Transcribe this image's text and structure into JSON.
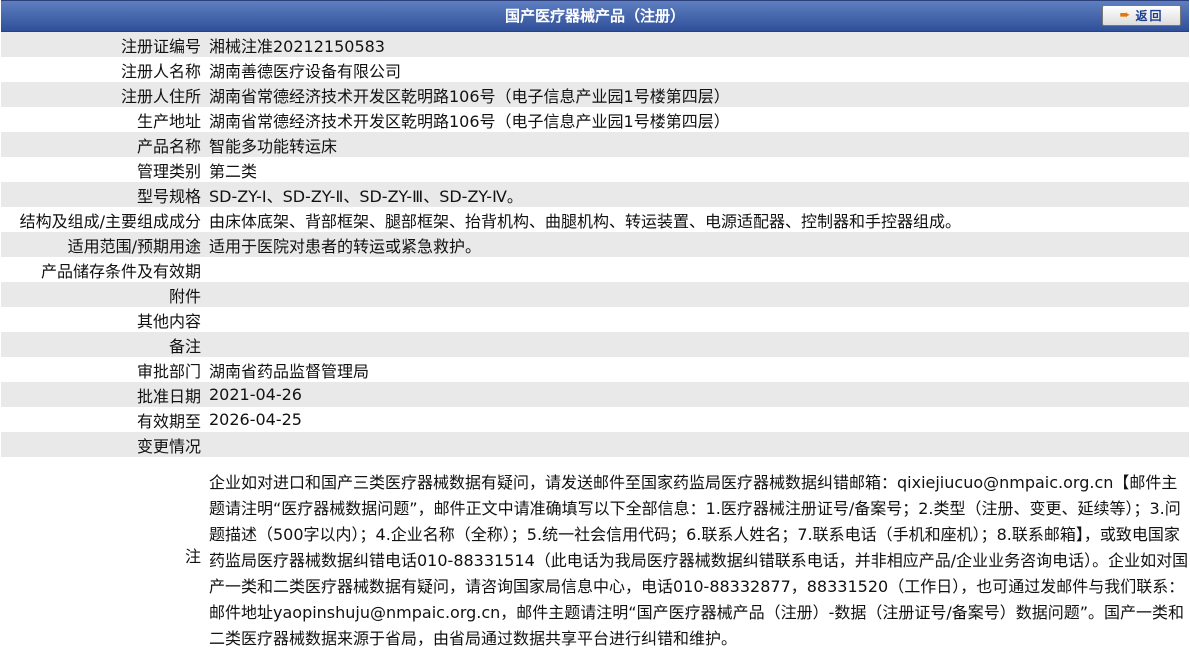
{
  "header": {
    "title": "国产医疗器械产品（注册）",
    "back_label": "返回",
    "back_icon": "arrow-right-icon"
  },
  "rows": [
    {
      "label": "注册证编号",
      "value": "湘械注准20212150583"
    },
    {
      "label": "注册人名称",
      "value": "湖南善德医疗设备有限公司"
    },
    {
      "label": "注册人住所",
      "value": "湖南省常德经济技术开发区乾明路106号（电子信息产业园1号楼第四层）"
    },
    {
      "label": "生产地址",
      "value": "湖南省常德经济技术开发区乾明路106号（电子信息产业园1号楼第四层）"
    },
    {
      "label": "产品名称",
      "value": "智能多功能转运床"
    },
    {
      "label": "管理类别",
      "value": "第二类"
    },
    {
      "label": "型号规格",
      "value": "SD-ZY-Ⅰ、SD-ZY-Ⅱ、SD-ZY-Ⅲ、SD-ZY-Ⅳ。"
    },
    {
      "label": "结构及组成/主要组成成分",
      "value": "由床体底架、背部框架、腿部框架、抬背机构、曲腿机构、转运装置、电源适配器、控制器和手控器组成。"
    },
    {
      "label": "适用范围/预期用途",
      "value": "适用于医院对患者的转运或紧急救护。"
    },
    {
      "label": "产品储存条件及有效期",
      "value": ""
    },
    {
      "label": "附件",
      "value": ""
    },
    {
      "label": "其他内容",
      "value": ""
    },
    {
      "label": "备注",
      "value": ""
    },
    {
      "label": "审批部门",
      "value": "湖南省药品监督管理局"
    },
    {
      "label": "批准日期",
      "value": "2021-04-26"
    },
    {
      "label": "有效期至",
      "value": "2026-04-25"
    },
    {
      "label": "变更情况",
      "value": ""
    }
  ],
  "note": {
    "label": "注",
    "text": "企业如对进口和国产三类医疗器械数据有疑问，请发送邮件至国家药监局医疗器械数据纠错邮箱：qixiejiucuo@nmpaic.org.cn【邮件主题请注明“医疗器械数据问题”，邮件正文中请准确填写以下全部信息：1.医疗器械注册证号/备案号；2.类型（注册、变更、延续等）；3.问题描述（500字以内）；4.企业名称（全称）；5.统一社会信用代码；6.联系人姓名；7.联系电话（手机和座机）；8.联系邮箱】，或致电国家药监局医疗器械数据纠错电话010-88331514（此电话为我局医疗器械数据纠错联系电话，并非相应产品/企业业务咨询电话）。企业如对国产一类和二类医疗器械数据有疑问，请咨询国家局信息中心，电话010-88332877，88331520（工作日），也可通过发邮件与我们联系：邮件地址yaopinshuju@nmpaic.org.cn，邮件主题请注明“国产医疗器械产品（注册）-数据（注册证号/备案号）数据问题”。国产一类和二类医疗器械数据来源于省局，由省局通过数据共享平台进行纠错和维护。"
  }
}
